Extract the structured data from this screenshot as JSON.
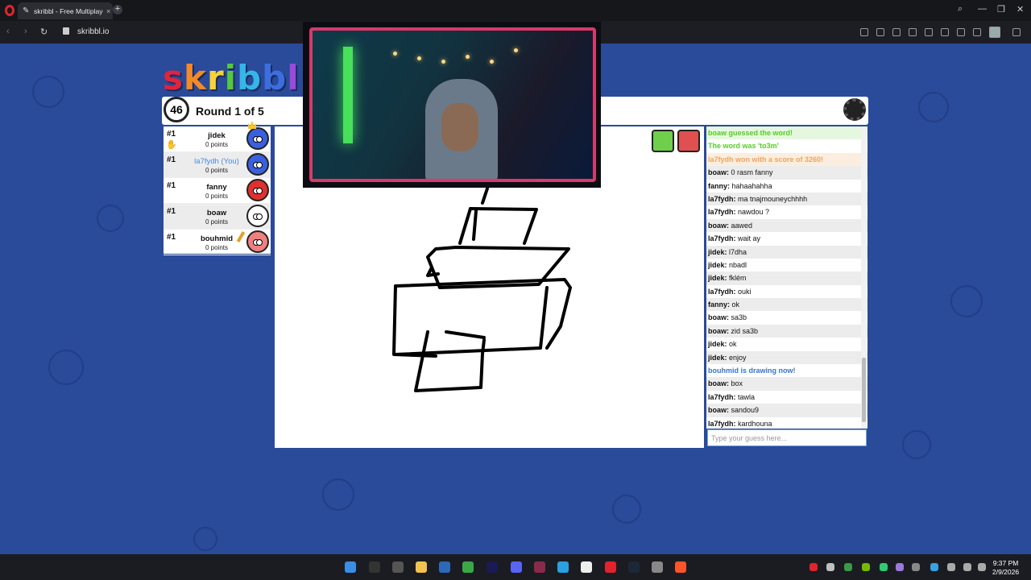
{
  "browser": {
    "tab_title": "skribbl - Free Multiplayer",
    "url": "skribbl.io"
  },
  "game": {
    "logo_text": "skribbl.io",
    "logo_colors": [
      "#e0243a",
      "#f28a2a",
      "#f5d23a",
      "#55c93d",
      "#35b5e8",
      "#3c6ee0",
      "#9a4ad8",
      "#e04ab8",
      "#e0243a",
      "#f28a2a"
    ],
    "timer": "46",
    "round_text": "Round 1 of 5"
  },
  "players": [
    {
      "rank": "#1",
      "name": "jidek",
      "points": "0 points",
      "color": "#3a5fe0",
      "you": false
    },
    {
      "rank": "#1",
      "name": "la7fydh (You)",
      "points": "0 points",
      "color": "#3a5fe0",
      "you": true
    },
    {
      "rank": "#1",
      "name": "fanny",
      "points": "0 points",
      "color": "#e03030",
      "you": false
    },
    {
      "rank": "#1",
      "name": "boaw",
      "points": "0 points",
      "color": "#ffffff",
      "you": false
    },
    {
      "rank": "#1",
      "name": "bouhmid",
      "points": "0 points",
      "color": "#f08080",
      "you": false
    }
  ],
  "chat": [
    {
      "type": "green",
      "author": "",
      "text": "boaw guessed the word!"
    },
    {
      "type": "green2",
      "author": "",
      "text": "The word was 'to3m'"
    },
    {
      "type": "orange",
      "author": "",
      "text": "la7fydh won with a score of 3260!"
    },
    {
      "type": "normal",
      "author": "boaw:",
      "text": "0 rasm fanny"
    },
    {
      "type": "normal",
      "author": "fanny:",
      "text": "hahaahahha"
    },
    {
      "type": "normal",
      "author": "la7fydh:",
      "text": "ma tnajmouneychhhh"
    },
    {
      "type": "normal",
      "author": "la7fydh:",
      "text": "nawdou ?"
    },
    {
      "type": "normal",
      "author": "boaw:",
      "text": "aawed"
    },
    {
      "type": "normal",
      "author": "la7fydh:",
      "text": "wait ay"
    },
    {
      "type": "normal",
      "author": "jidek:",
      "text": "l7dha"
    },
    {
      "type": "normal",
      "author": "jidek:",
      "text": "nbadl"
    },
    {
      "type": "normal",
      "author": "jidek:",
      "text": "fklém"
    },
    {
      "type": "normal",
      "author": "la7fydh:",
      "text": "ouki"
    },
    {
      "type": "normal",
      "author": "fanny:",
      "text": "ok"
    },
    {
      "type": "normal",
      "author": "boaw:",
      "text": "sa3b"
    },
    {
      "type": "normal",
      "author": "boaw:",
      "text": "zid sa3b"
    },
    {
      "type": "normal",
      "author": "jidek:",
      "text": "ok"
    },
    {
      "type": "normal",
      "author": "jidek:",
      "text": "enjoy"
    },
    {
      "type": "blue",
      "author": "",
      "text": "bouhmid is drawing now!"
    },
    {
      "type": "normal",
      "author": "boaw:",
      "text": "box"
    },
    {
      "type": "normal",
      "author": "la7fydh:",
      "text": "tawla"
    },
    {
      "type": "normal",
      "author": "boaw:",
      "text": "sandou9"
    },
    {
      "type": "normal",
      "author": "la7fydh:",
      "text": "kardhouna"
    }
  ],
  "guess_input": {
    "placeholder": "Type your guess here..."
  },
  "taskbar": {
    "time": "9:37 PM",
    "date": "2/9/2026"
  }
}
